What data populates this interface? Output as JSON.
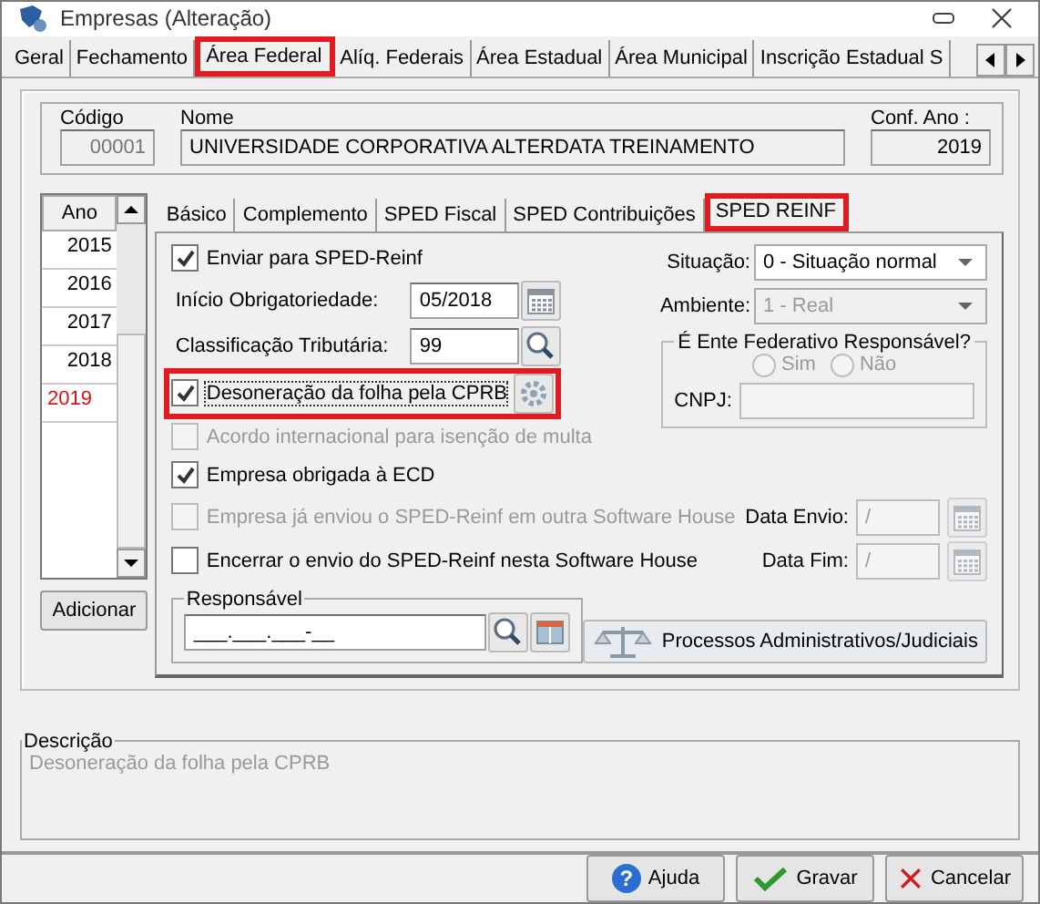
{
  "window": {
    "title": "Empresas (Alteração)"
  },
  "tabs": [
    {
      "label": "Geral",
      "selected": false,
      "highlighted": false
    },
    {
      "label": "Fechamento",
      "selected": false,
      "highlighted": false
    },
    {
      "label": "Área Federal",
      "selected": true,
      "highlighted": true
    },
    {
      "label": "Alíq. Federais",
      "selected": false,
      "highlighted": false
    },
    {
      "label": "Área Estadual",
      "selected": false,
      "highlighted": false
    },
    {
      "label": "Área Municipal",
      "selected": false,
      "highlighted": false
    },
    {
      "label": "Inscrição Estadual S",
      "selected": false,
      "highlighted": false
    }
  ],
  "header": {
    "codigo": {
      "label": "Código",
      "value": "00001"
    },
    "nome": {
      "label": "Nome",
      "value": "UNIVERSIDADE CORPORATIVA ALTERDATA TREINAMENTO"
    },
    "conf_ano": {
      "label": "Conf. Ano :",
      "value": "2019"
    }
  },
  "years": {
    "header": "Ano",
    "items": [
      {
        "label": "2015",
        "selected": false
      },
      {
        "label": "2016",
        "selected": false
      },
      {
        "label": "2017",
        "selected": false
      },
      {
        "label": "2018",
        "selected": false
      },
      {
        "label": "2019",
        "selected": true
      }
    ],
    "add_button": "Adicionar"
  },
  "subtabs": [
    {
      "label": "Básico",
      "selected": false,
      "highlighted": false
    },
    {
      "label": "Complemento",
      "selected": false,
      "highlighted": false
    },
    {
      "label": "SPED Fiscal",
      "selected": false,
      "highlighted": false
    },
    {
      "label": "SPED Contribuições",
      "selected": false,
      "highlighted": false
    },
    {
      "label": "SPED REINF",
      "selected": true,
      "highlighted": true
    }
  ],
  "left_rows": [
    {
      "kind": "checkbox",
      "label": "Enviar para SPED-Reinf",
      "checked": true,
      "disabled": false,
      "highlighted": false,
      "settings": false
    },
    {
      "kind": "date_field",
      "label": "Início Obrigatoriedade:",
      "value": "05/2018"
    },
    {
      "kind": "lookup_field",
      "label": "Classificação Tributária:",
      "value": "99"
    },
    {
      "kind": "checkbox",
      "label": "Desoneração da folha pela CPRB",
      "checked": true,
      "disabled": false,
      "highlighted": true,
      "settings": true
    },
    {
      "kind": "checkbox",
      "label": "Acordo internacional para isenção de multa",
      "checked": false,
      "disabled": true,
      "highlighted": false,
      "settings": false
    },
    {
      "kind": "checkbox",
      "label": "Empresa obrigada à ECD",
      "checked": true,
      "disabled": false,
      "highlighted": false,
      "settings": false
    }
  ],
  "selects": [
    {
      "label": "Situação:",
      "value": "0 - Situação normal",
      "disabled": false
    },
    {
      "label": "Ambiente:",
      "value": "1 - Real",
      "disabled": true
    }
  ],
  "ente_group": {
    "title": "É Ente Federativo Responsável?",
    "options": [
      {
        "label": "Sim",
        "selected": false
      },
      {
        "label": "Não",
        "selected": false
      }
    ],
    "cnpj_label": "CNPJ:"
  },
  "bottom_rows": [
    {
      "label": "Empresa já enviou o SPED-Reinf em outra Software House",
      "checked": false,
      "disabled": true,
      "date_label": "Data Envio:",
      "date_value": "/"
    },
    {
      "label": "Encerrar o envio do SPED-Reinf nesta Software House",
      "checked": false,
      "disabled": false,
      "date_label": "Data Fim:",
      "date_value": "/"
    }
  ],
  "responsavel": {
    "title": "Responsável",
    "value": "___.___.___-__"
  },
  "processos_button": "Processos Administrativos/Judiciais",
  "descricao": {
    "title": "Descrição",
    "text": "Desoneração da folha pela CPRB"
  },
  "buttons": [
    {
      "kind": "help",
      "icon": "?",
      "label": "Ajuda"
    },
    {
      "kind": "save",
      "label": "Gravar"
    },
    {
      "kind": "cancel",
      "label": "Cancelar"
    }
  ]
}
